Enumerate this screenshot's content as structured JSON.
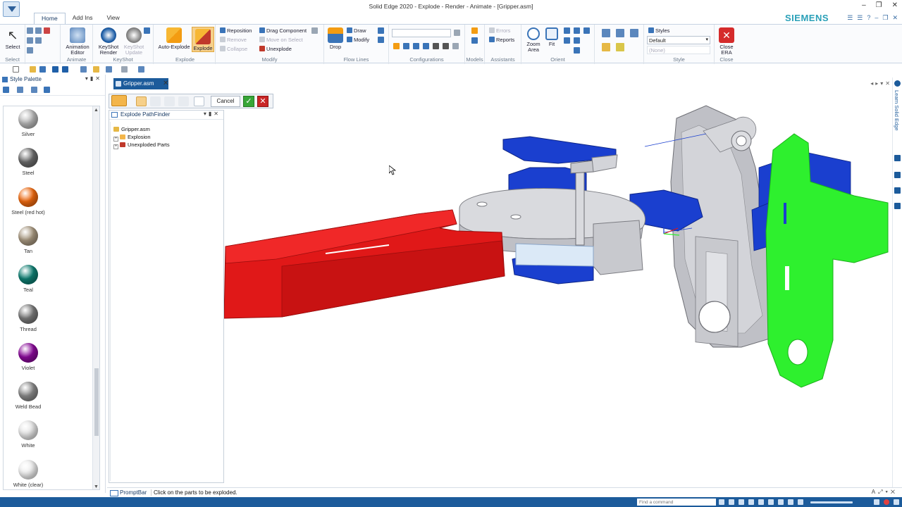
{
  "window": {
    "title": "Solid Edge 2020 - Explode - Render - Animate - [Gripper.asm]",
    "brand": "SIEMENS"
  },
  "ribbon_tabs": [
    {
      "label": "Home",
      "active": true
    },
    {
      "label": "Add Ins"
    },
    {
      "label": "View"
    }
  ],
  "ribbon": {
    "select": {
      "button": "Select",
      "group": "Select"
    },
    "animate": {
      "button1": "Animation",
      "button2": "Editor",
      "group": "Animate"
    },
    "keyshot": {
      "render1": "KeyShot",
      "render2": "Render",
      "update1": "KeyShot",
      "update2": "Update",
      "group": "KeyShot"
    },
    "explode": {
      "auto": "Auto-Explode",
      "explode": "Explode",
      "group": "Explode"
    },
    "modify": {
      "reposition": "Reposition",
      "remove": "Remove",
      "collapse": "Collapse",
      "drag": "Drag Component",
      "move_on_select": "Move on Select",
      "unexplode": "Unexplode",
      "group": "Modify"
    },
    "flow": {
      "drop": "Drop",
      "draw": "Draw",
      "modify": "Modify",
      "group": "Flow Lines"
    },
    "configurations": {
      "group": "Configurations"
    },
    "models": {
      "group": "Models"
    },
    "assistants": {
      "errors": "Errors",
      "reports": "Reports",
      "group": "Assistants"
    },
    "orient": {
      "zoom1": "Zoom",
      "zoom2": "Area",
      "fit": "Fit",
      "group": "Orient"
    },
    "style": {
      "styles": "Styles",
      "selected": "Default",
      "secondary": "(None)",
      "group": "Style"
    },
    "close": {
      "l1": "Close",
      "l2": "ERA",
      "group": "Close"
    }
  },
  "palette": {
    "title": "Style Palette",
    "materials": [
      {
        "name": "Silver",
        "color": "#b8b8b8"
      },
      {
        "name": "Steel",
        "color": "#6b6b6b"
      },
      {
        "name": "Steel (red hot)",
        "color": "#f06a10"
      },
      {
        "name": "Tan",
        "color": "#a89880"
      },
      {
        "name": "Teal",
        "color": "#0f7f73"
      },
      {
        "name": "Thread",
        "color": "#7a7a7a"
      },
      {
        "name": "Violet",
        "color": "#8a0a9a"
      },
      {
        "name": "Weld Bead",
        "color": "#8a8a8a"
      },
      {
        "name": "White",
        "color": "#e6e6e6"
      },
      {
        "name": "White (clear)",
        "color": "#efefef"
      }
    ]
  },
  "document_tab": {
    "label": "Gripper.asm"
  },
  "command_bar": {
    "cancel": "Cancel",
    "accept": "✓",
    "reject": "✕"
  },
  "pathfinder": {
    "title": "Explode PathFinder",
    "tree": [
      {
        "label": "Gripper.asm"
      },
      {
        "label": "Explosion"
      },
      {
        "label": "Unexploded Parts"
      }
    ]
  },
  "learn_label": "Learn Solid Edge",
  "status": {
    "promptbar": "PromptBar",
    "prompt": "Click on the parts to be exploded.",
    "find_placeholder": "Find a command"
  },
  "colors": {
    "accent": "#1c5b9b",
    "red_part": "#e01818",
    "blue_part": "#1a3fcf",
    "green_part": "#2ef02e",
    "gray_part": "#c8c8cc"
  }
}
